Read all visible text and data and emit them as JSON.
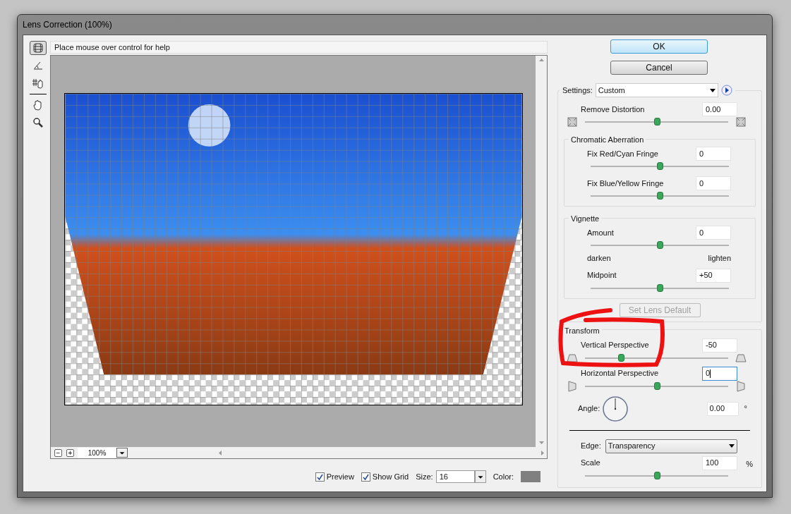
{
  "window": {
    "title": "Lens Correction (100%)"
  },
  "tools": [
    {
      "kind": "distortion",
      "selected": true
    },
    {
      "kind": "straighten",
      "selected": false
    },
    {
      "kind": "grid",
      "selected": false
    },
    {
      "kind": "hand",
      "selected": false
    },
    {
      "kind": "zoom",
      "selected": false
    }
  ],
  "help_text": "Place mouse over control for help",
  "zoom": {
    "minus": "−",
    "plus": "+",
    "value": "100%"
  },
  "buttons": [
    {
      "label": "OK",
      "default": true
    },
    {
      "label": "Cancel",
      "default": false
    }
  ],
  "settings": {
    "label": "Settings:",
    "value": "Custom"
  },
  "distortion": {
    "label": "Remove Distortion",
    "value": "0.00",
    "level": 0.5
  },
  "chromatic": {
    "title": "Chromatic Aberration",
    "sliders": [
      {
        "label": "Fix Red/Cyan Fringe",
        "value": "0",
        "level": 0.5
      },
      {
        "label": "Fix Blue/Yellow Fringe",
        "value": "0",
        "level": 0.5
      }
    ]
  },
  "vignette": {
    "title": "Vignette",
    "sliders": [
      {
        "label": "Amount",
        "value": "0",
        "level": 0.5,
        "low_label": "darken",
        "high_label": "lighten"
      },
      {
        "label": "Midpoint",
        "value": "+50",
        "level": 0.5
      }
    ]
  },
  "lens_default": {
    "label": "Set Lens Default",
    "disabled": true
  },
  "transform": {
    "title": "Transform",
    "sliders": [
      {
        "label": "Vertical Perspective",
        "value": "-50",
        "level": 0.25,
        "focused": false,
        "kind": "vertical"
      },
      {
        "label": "Horizontal Perspective",
        "value": "0",
        "level": 0.5,
        "focused": true,
        "kind": "horizontal"
      }
    ],
    "angle": {
      "label": "Angle:",
      "value": "0.00",
      "unit": "°"
    },
    "edge": {
      "label": "Edge:",
      "value": "Transparency"
    },
    "scale": {
      "label": "Scale",
      "value": "100",
      "unit": "%",
      "level": 0.5
    }
  },
  "footer": {
    "checkboxes": [
      {
        "label": "Preview",
        "checked": true
      },
      {
        "label": "Show Grid",
        "checked": true
      }
    ],
    "size": {
      "label": "Size:",
      "value": "16"
    },
    "color": {
      "label": "Color:"
    }
  }
}
